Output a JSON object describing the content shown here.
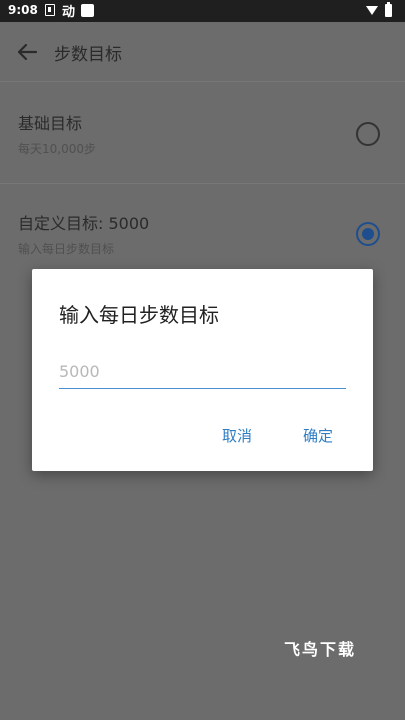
{
  "status_bar": {
    "time": "9:08",
    "notification_text": "动"
  },
  "toolbar": {
    "title": "步数目标",
    "back_icon": "arrow-left-icon"
  },
  "options": [
    {
      "title": "基础目标",
      "subtitle": "每天10,000步",
      "selected": false
    },
    {
      "title": "自定义目标: 5000",
      "subtitle": "输入每日步数目标",
      "selected": true
    }
  ],
  "dialog": {
    "title": "输入每日步数目标",
    "input_placeholder": "5000",
    "input_value": "",
    "cancel_label": "取消",
    "ok_label": "确定"
  },
  "watermark": "飞鸟下载",
  "colors": {
    "accent": "#2f7ec4",
    "radio_selected": "#1e4e8e",
    "scrim": "#6c6c6c"
  }
}
